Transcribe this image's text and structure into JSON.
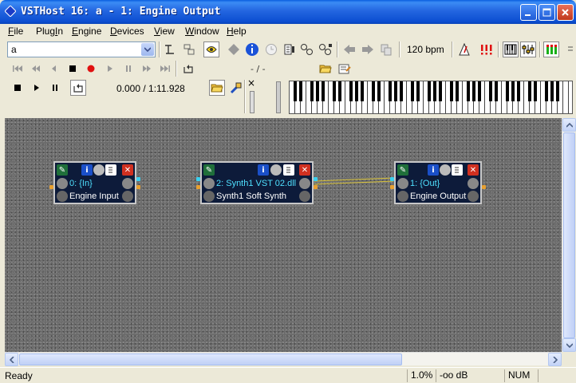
{
  "window": {
    "title": "VSTHost 16: a - 1: Engine Output"
  },
  "menu": {
    "items": [
      {
        "pre": "",
        "u": "F",
        "post": "ile"
      },
      {
        "pre": "Plug",
        "u": "I",
        "post": "n"
      },
      {
        "pre": "",
        "u": "E",
        "post": "ngine"
      },
      {
        "pre": "",
        "u": "D",
        "post": "evices"
      },
      {
        "pre": "",
        "u": "V",
        "post": "iew"
      },
      {
        "pre": "",
        "u": "W",
        "post": "indow"
      },
      {
        "pre": "",
        "u": "H",
        "post": "elp"
      }
    ]
  },
  "toolbar": {
    "bank_combo_value": "a",
    "bpm": "120 bpm",
    "position": "- / -",
    "time": "0.000 / 1:11.928"
  },
  "plugins": [
    {
      "index_label": "0: {In}",
      "name": "Engine Input"
    },
    {
      "index_label": "2: Synth1 VST 02.dll",
      "name": "Synth1 Soft Synth"
    },
    {
      "index_label": "1: {Out}",
      "name": "Engine Output"
    }
  ],
  "status": {
    "text": "Ready",
    "cpu": "1.0%",
    "level": "-oo dB",
    "num": "NUM"
  },
  "colors": {
    "title_blue": "#0b4ed1",
    "plugin_bg": "#0d1b3a",
    "connection": "#d8c23a",
    "record_red": "#e01010"
  }
}
